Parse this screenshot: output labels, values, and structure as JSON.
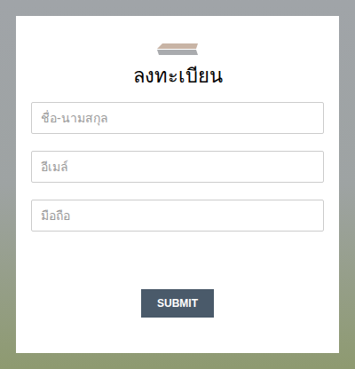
{
  "form": {
    "title": "ลงทะเบียน",
    "fields": [
      {
        "placeholder": "ชื่อ-นามสกุล"
      },
      {
        "placeholder": "อีเมล์"
      },
      {
        "placeholder": "มือถือ"
      }
    ],
    "submit": "SUBMIT"
  }
}
